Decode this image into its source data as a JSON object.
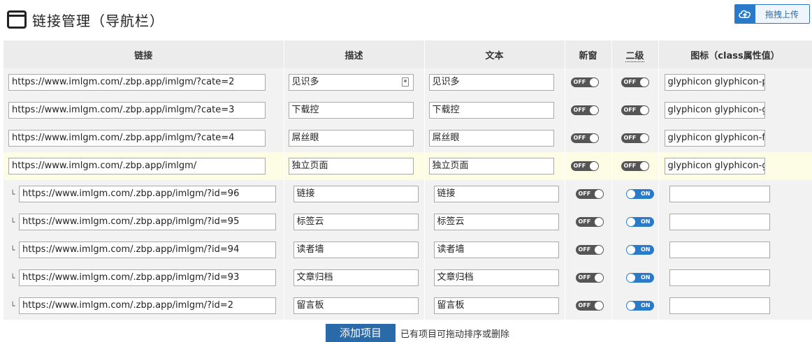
{
  "header": {
    "title": "链接管理（导航栏）",
    "upload_label": "拖拽上传"
  },
  "columns": {
    "link": "链接",
    "desc": "描述",
    "text": "文本",
    "newwin": "新窗",
    "level2": "二级",
    "icon": "图标（class属性值）"
  },
  "rows": [
    {
      "link": "https://www.imlgm.com/.zbp.app/imlgm/?cate=2",
      "desc": "见识多",
      "text": "见识多",
      "newwin": "OFF",
      "level2": "OFF",
      "icon": "glyphicon glyphicon-p",
      "sub": false,
      "highlight": false
    },
    {
      "link": "https://www.imlgm.com/.zbp.app/imlgm/?cate=3",
      "desc": "下载控",
      "text": "下载控",
      "newwin": "OFF",
      "level2": "OFF",
      "icon": "glyphicon glyphicon-g",
      "sub": false,
      "highlight": false
    },
    {
      "link": "https://www.imlgm.com/.zbp.app/imlgm/?cate=4",
      "desc": "屌丝眼",
      "text": "屌丝眼",
      "newwin": "OFF",
      "level2": "OFF",
      "icon": "glyphicon glyphicon-fi",
      "sub": false,
      "highlight": false
    },
    {
      "link": "https://www.imlgm.com/.zbp.app/imlgm/",
      "desc": "独立页面",
      "text": "独立页面",
      "newwin": "OFF",
      "level2": "OFF",
      "icon": "glyphicon glyphicon-g",
      "sub": false,
      "highlight": true
    },
    {
      "link": "https://www.imlgm.com/.zbp.app/imlgm/?id=96",
      "desc": "链接",
      "text": "链接",
      "newwin": "OFF",
      "level2": "ON",
      "icon": "",
      "sub": true,
      "highlight": false
    },
    {
      "link": "https://www.imlgm.com/.zbp.app/imlgm/?id=95",
      "desc": "标签云",
      "text": "标签云",
      "newwin": "OFF",
      "level2": "ON",
      "icon": "",
      "sub": true,
      "highlight": false
    },
    {
      "link": "https://www.imlgm.com/.zbp.app/imlgm/?id=94",
      "desc": "读者墙",
      "text": "读者墙",
      "newwin": "OFF",
      "level2": "ON",
      "icon": "",
      "sub": true,
      "highlight": false
    },
    {
      "link": "https://www.imlgm.com/.zbp.app/imlgm/?id=93",
      "desc": "文章归档",
      "text": "文章归档",
      "newwin": "OFF",
      "level2": "ON",
      "icon": "",
      "sub": true,
      "highlight": false
    },
    {
      "link": "https://www.imlgm.com/.zbp.app/imlgm/?id=2",
      "desc": "留言板",
      "text": "留言板",
      "newwin": "OFF",
      "level2": "ON",
      "icon": "",
      "sub": true,
      "highlight": false
    }
  ],
  "tree_glyph": "└",
  "footer": {
    "add_label": "添加项目",
    "hint": "已有项目可拖动排序或删除"
  },
  "icons": {
    "title": "window-icon",
    "upload": "cloud-upload-icon",
    "contact": "contact-card-icon"
  },
  "colors": {
    "accent": "#2a7ac9",
    "button": "#2a6aa9",
    "highlight_row": "#fdfde6",
    "toggle_off": "#555555"
  }
}
